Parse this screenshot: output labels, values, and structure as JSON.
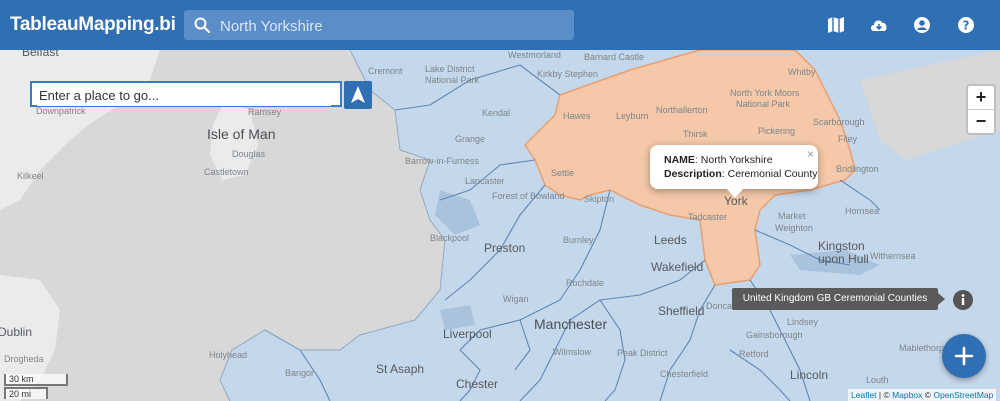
{
  "header": {
    "brand": "TableauMapping.bi",
    "search_value": "North Yorkshire",
    "icons": [
      "map-icon",
      "cloud-download-icon",
      "account-icon",
      "help-icon"
    ]
  },
  "map": {
    "goto_placeholder": "Enter a place to go...",
    "zoom_in": "+",
    "zoom_out": "−",
    "highlight_color": "#f4c8a8",
    "region_color": "#c5d7ea",
    "popup": {
      "name_label": "NAME",
      "name_value": "North Yorkshire",
      "description_label": "Description",
      "description_value": "Ceremonial County",
      "close": "×"
    },
    "layer_label": "United Kingdom GB Ceremonial Counties",
    "fab_label": "+",
    "scale": {
      "km": "30 km",
      "mi": "20 mi"
    },
    "attribution": {
      "leaflet": "Leaflet",
      "mapbox": "Mapbox",
      "osm": "OpenStreetMap"
    },
    "places": [
      {
        "name": "Belfast",
        "cls": "mid"
      },
      {
        "name": "Isle of Man",
        "cls": "big"
      },
      {
        "name": "Ramsey",
        "cls": "small"
      },
      {
        "name": "Douglas",
        "cls": "small"
      },
      {
        "name": "Castletown",
        "cls": "small"
      },
      {
        "name": "Downpatrick",
        "cls": "small"
      },
      {
        "name": "Kilkeel",
        "cls": "small"
      },
      {
        "name": "Cremont",
        "cls": "small"
      },
      {
        "name": "Lake District",
        "cls": "small"
      },
      {
        "name": "National Park",
        "cls": "small"
      },
      {
        "name": "Westmorland",
        "cls": "small"
      },
      {
        "name": "Kirkby Stephen",
        "cls": "small"
      },
      {
        "name": "Barnard Castle",
        "cls": "small"
      },
      {
        "name": "Whitby",
        "cls": "small"
      },
      {
        "name": "North York Moors",
        "cls": "small"
      },
      {
        "name": "National Park",
        "cls": "small"
      },
      {
        "name": "Northallerton",
        "cls": "small"
      },
      {
        "name": "Hawes",
        "cls": "small"
      },
      {
        "name": "Leyburn",
        "cls": "small"
      },
      {
        "name": "Kendal",
        "cls": "small"
      },
      {
        "name": "Grange",
        "cls": "small"
      },
      {
        "name": "Thirsk",
        "cls": "small"
      },
      {
        "name": "Pickering",
        "cls": "small"
      },
      {
        "name": "Scarborough",
        "cls": "small"
      },
      {
        "name": "Filey",
        "cls": "small"
      },
      {
        "name": "Barrow-in-Furness",
        "cls": "small"
      },
      {
        "name": "Lancaster",
        "cls": "small"
      },
      {
        "name": "Settle",
        "cls": "small"
      },
      {
        "name": "Forest of Bowland",
        "cls": "small"
      },
      {
        "name": "Skipton",
        "cls": "small"
      },
      {
        "name": "York",
        "cls": "mid"
      },
      {
        "name": "Tadcaster",
        "cls": "small"
      },
      {
        "name": "Bridlington",
        "cls": "small"
      },
      {
        "name": "Market",
        "cls": "small"
      },
      {
        "name": "Weighton",
        "cls": "small"
      },
      {
        "name": "Hornsea",
        "cls": "small"
      },
      {
        "name": "Blackpool",
        "cls": "small"
      },
      {
        "name": "Preston",
        "cls": "mid"
      },
      {
        "name": "Burnley",
        "cls": "small"
      },
      {
        "name": "Leeds",
        "cls": "mid"
      },
      {
        "name": "Kingston",
        "cls": "mid"
      },
      {
        "name": "upon Hull",
        "cls": "mid"
      },
      {
        "name": "Withernsea",
        "cls": "small"
      },
      {
        "name": "Wakefield",
        "cls": "mid"
      },
      {
        "name": "Rochdale",
        "cls": "small"
      },
      {
        "name": "Wigan",
        "cls": "small"
      },
      {
        "name": "Manchester",
        "cls": "big"
      },
      {
        "name": "Sheffield",
        "cls": "mid"
      },
      {
        "name": "Doncaster",
        "cls": "small"
      },
      {
        "name": "Lindsey",
        "cls": "small"
      },
      {
        "name": "Gainsborough",
        "cls": "small"
      },
      {
        "name": "Liverpool",
        "cls": "mid"
      },
      {
        "name": "Peak District",
        "cls": "small"
      },
      {
        "name": "Wilmslow",
        "cls": "small"
      },
      {
        "name": "Retford",
        "cls": "small"
      },
      {
        "name": "Mablethorpe",
        "cls": "small"
      },
      {
        "name": "Holyhead",
        "cls": "small"
      },
      {
        "name": "Bangor",
        "cls": "small"
      },
      {
        "name": "St Asaph",
        "cls": "mid"
      },
      {
        "name": "Chester",
        "cls": "mid"
      },
      {
        "name": "Chesterfield",
        "cls": "small"
      },
      {
        "name": "Lincoln",
        "cls": "mid"
      },
      {
        "name": "Louth",
        "cls": "small"
      },
      {
        "name": "Dublin",
        "cls": "mid"
      },
      {
        "name": "Drogheda",
        "cls": "small"
      }
    ]
  }
}
